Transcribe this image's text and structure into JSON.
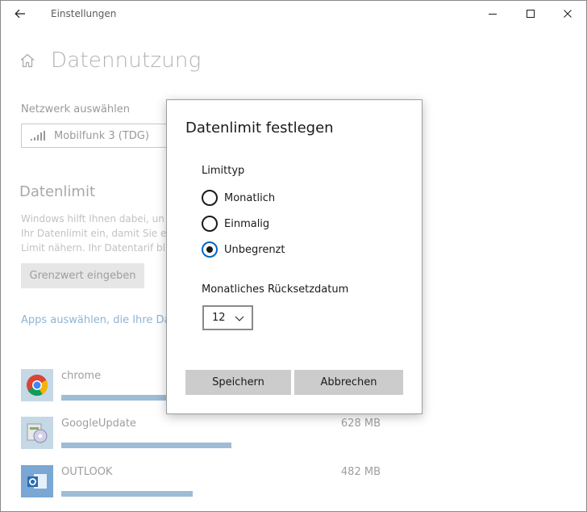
{
  "window": {
    "title": "Einstellungen",
    "back_icon": "arrow-left-icon",
    "controls": [
      "minimize-icon",
      "maximize-icon",
      "close-icon"
    ]
  },
  "page": {
    "title": "Datennutzung",
    "home_icon": "home-icon"
  },
  "network": {
    "label": "Netzwerk auswählen",
    "selected": "Mobilfunk 3 (TDG)",
    "icon": "signal-bars-icon"
  },
  "data_limit": {
    "heading": "Datenlimit",
    "desc_lines": [
      "Windows hilft Ihnen dabei, un",
      "Ihr Datenlimit ein, damit Sie e",
      "Limit nähern. Ihr Datentarif bl"
    ],
    "button": "Grenzwert eingeben"
  },
  "apps_link": "Apps auswählen, die Ihre Dat",
  "apps": [
    {
      "name": "chrome",
      "size": "",
      "usage_fraction": 0.5,
      "icon": "chrome-icon"
    },
    {
      "name": "GoogleUpdate",
      "size": "628 MB",
      "usage_fraction": 0.57,
      "icon": "google-update-icon"
    },
    {
      "name": "OUTLOOK",
      "size": "482 MB",
      "usage_fraction": 0.44,
      "icon": "outlook-icon"
    }
  ],
  "dialog": {
    "title": "Datenlimit festlegen",
    "limit_type_label": "Limittyp",
    "options": [
      {
        "label": "Monatlich",
        "checked": false
      },
      {
        "label": "Einmalig",
        "checked": false
      },
      {
        "label": "Unbegrenzt",
        "checked": true
      }
    ],
    "reset_label": "Monatliches Rücksetzdatum",
    "reset_day": "12",
    "save": "Speichern",
    "cancel": "Abbrechen"
  },
  "colors": {
    "accent": "#0067c0",
    "usage_bar": "#9fbcd6",
    "button_bg": "#cccccc"
  }
}
